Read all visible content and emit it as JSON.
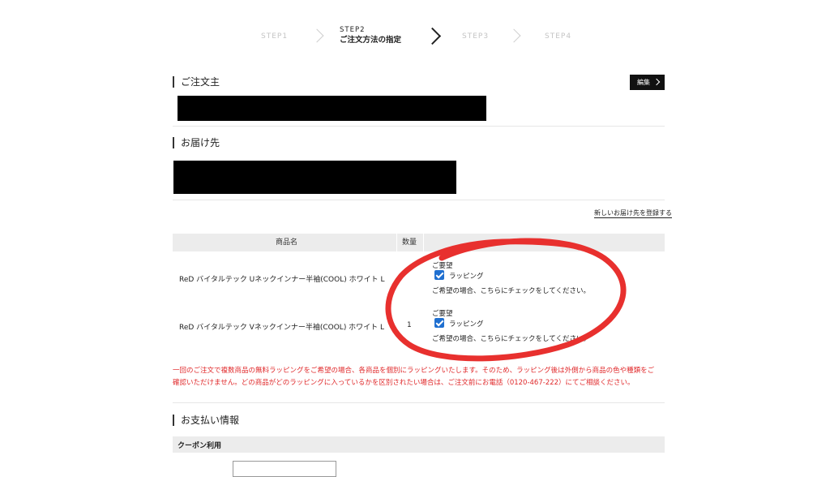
{
  "steps": [
    {
      "label": "STEP1"
    },
    {
      "label": "STEP2",
      "sub": "ご注文方法の指定"
    },
    {
      "label": "STEP3"
    },
    {
      "label": "STEP4"
    }
  ],
  "orderer": {
    "title": "ご注文主",
    "edit_label": "編集"
  },
  "delivery": {
    "title": "お届け先",
    "new_address_link": "新しいお届け先を登録する"
  },
  "table": {
    "headers": {
      "product": "商品名",
      "quantity": "数量"
    },
    "rows": [
      {
        "name": "ReD バイタルテック Uネックインナー半袖(COOL) ホワイト L",
        "quantity": "",
        "wrap_label": "ご要望",
        "checkbox_label": "ラッピング",
        "checked": true,
        "note": "ご希望の場合、こちらにチェックをしてください。"
      },
      {
        "name": "ReD バイタルテック Vネックインナー半袖(COOL) ホワイト L",
        "quantity": "1",
        "wrap_label": "ご要望",
        "checkbox_label": "ラッピング",
        "checked": true,
        "note": "ご希望の場合、こちらにチェックをしてください。"
      }
    ]
  },
  "notice": {
    "line1": "一回のご注文で複数商品の無料ラッピングをご希望の場合、各商品を個別にラッピングいたします。そのため、ラッピング後は外側から商品の色や種類をご",
    "line2": "確認いただけません。どの商品がどのラッピングに入っているかを区別されたい場合は、ご注文前にお電話（0120-467-222）にてご相談ください。"
  },
  "payment": {
    "title": "お支払い情報",
    "coupon_label": "クーポン利用"
  },
  "colors": {
    "annotation": "#e8302e",
    "checkbox": "#1f6fd0",
    "notice": "#e0282a"
  }
}
